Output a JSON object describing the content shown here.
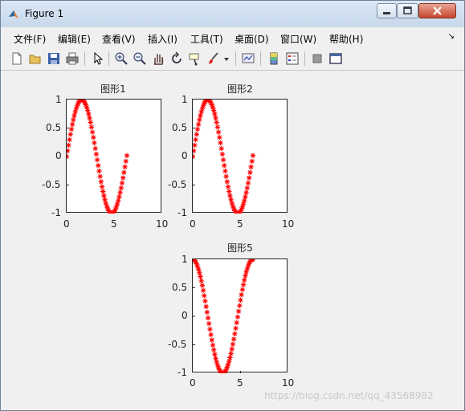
{
  "window": {
    "title": "Figure 1",
    "menu": [
      "文件(F)",
      "编辑(E)",
      "查看(V)",
      "插入(I)",
      "工具(T)",
      "桌面(D)",
      "窗口(W)",
      "帮助(H)"
    ],
    "toolbar_icons": [
      "new-figure-icon",
      "open-file-icon",
      "save-icon",
      "print-icon",
      "pointer-icon",
      "zoom-in-icon",
      "zoom-out-icon",
      "pan-icon",
      "rotate-icon",
      "data-cursor-icon",
      "brush-icon",
      "brush-dropdown-icon",
      "link-plot-icon",
      "colorbar-icon",
      "legend-icon",
      "hide-plot-tools-icon",
      "show-plot-tools-icon"
    ]
  },
  "watermark": "https://blog.csdn.net/qq_43568982",
  "chart_data": [
    {
      "type": "scatter",
      "title": "图形1",
      "xlabel": "",
      "ylabel": "",
      "xlim": [
        0,
        10
      ],
      "ylim": [
        -1,
        1
      ],
      "x_ticks": [
        "0",
        "5",
        "10"
      ],
      "y_ticks": [
        "1",
        "0.5",
        "0",
        "-0.5",
        "-1"
      ],
      "series": [
        {
          "function": "sin",
          "x_start": 0,
          "x_end": 6.3,
          "x_step": 0.1,
          "marker": "*",
          "color": "#ff0000"
        }
      ]
    },
    {
      "type": "scatter",
      "title": "图形2",
      "xlabel": "",
      "ylabel": "",
      "xlim": [
        0,
        10
      ],
      "ylim": [
        -1,
        1
      ],
      "x_ticks": [
        "0",
        "5",
        "10"
      ],
      "y_ticks": [
        "1",
        "0.5",
        "0",
        "-0.5",
        "-1"
      ],
      "series": [
        {
          "function": "sin",
          "x_start": 0,
          "x_end": 6.3,
          "x_step": 0.1,
          "marker": "*",
          "color": "#ff0000"
        }
      ]
    },
    {
      "type": "scatter",
      "title": "图形5",
      "xlabel": "",
      "ylabel": "",
      "xlim": [
        0,
        10
      ],
      "ylim": [
        -1,
        1
      ],
      "x_ticks": [
        "0",
        "5",
        "10"
      ],
      "y_ticks": [
        "1",
        "0.5",
        "0",
        "-0.5",
        "-1"
      ],
      "series": [
        {
          "function": "cos",
          "x_start": 0,
          "x_end": 6.3,
          "x_step": 0.1,
          "marker": "*",
          "color": "#ff0000"
        }
      ]
    }
  ]
}
